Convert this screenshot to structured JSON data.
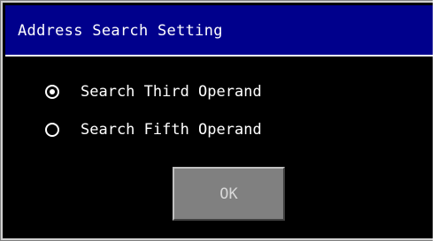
{
  "dialog": {
    "title": "Address Search Setting",
    "options": [
      {
        "label": "Search Third Operand",
        "selected": true
      },
      {
        "label": "Search Fifth Operand",
        "selected": false
      }
    ],
    "ok_label": "OK"
  },
  "colors": {
    "titlebar": "#00008c",
    "background": "#000000",
    "text": "#ffffff",
    "button": "#808080"
  }
}
